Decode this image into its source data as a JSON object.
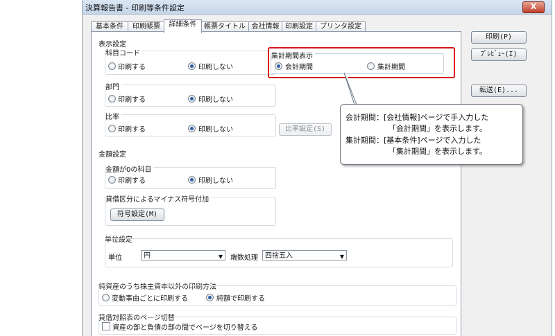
{
  "window": {
    "title": "決算報告書 - 印刷等条件設定",
    "close_label": "X"
  },
  "tabs": [
    {
      "label": "基本条件",
      "active": false
    },
    {
      "label": "印刷帳票",
      "active": false
    },
    {
      "label": "詳細条件",
      "active": true
    },
    {
      "label": "帳票タイトル",
      "active": false
    },
    {
      "label": "会社情報",
      "active": false
    },
    {
      "label": "印刷設定",
      "active": false
    },
    {
      "label": "プリンタ設定",
      "active": false
    }
  ],
  "side_buttons": {
    "print": "印刷(P)",
    "preview": "ﾌﾟﾚﾋﾞｭｰ(I)",
    "transfer": "転送(E)..."
  },
  "display_settings": {
    "title": "表示設定",
    "subject_code": {
      "label": "科目コード",
      "opt_print": "印刷する",
      "opt_noprint": "印刷しない"
    },
    "department": {
      "label": "部門",
      "opt_print": "印刷する",
      "opt_noprint": "印刷しない"
    },
    "ratio": {
      "label": "比率",
      "opt_print": "印刷する",
      "opt_noprint": "印刷しない",
      "settings_button": "比率設定(S)"
    },
    "aggregation_period": {
      "label": "集計期間表示",
      "opt_company": "会計期間",
      "opt_aggregate": "集計期間"
    }
  },
  "amount_settings": {
    "title": "金額設定",
    "zero_amount": {
      "label": "金額が0の科目",
      "opt_print": "印刷する",
      "opt_noprint": "印刷しない"
    },
    "minus_sign": {
      "label": "貸借区分によるマイナス符号付加",
      "button": "符号設定(M)"
    },
    "unit": {
      "title": "単位設定",
      "unit_label": "単位",
      "unit_value": "円",
      "rounding_label": "端数処理",
      "rounding_value": "四捨五入"
    }
  },
  "net_assets": {
    "title": "純資産のうち株主資本以外の印刷方法",
    "opt_each": "変動事由ごとに印刷する",
    "opt_total": "純額で印刷する"
  },
  "balance_page": {
    "title": "貸借対照表のページ切替",
    "checkbox_label": "資産の部と負債の部の間でページを切り替える"
  },
  "callout": {
    "line1": "会計期間：[会社情報]ページで手入力した",
    "line2": "「会計期間」を表示します。",
    "line3": "集計期間：[基本条件]ページで入力した",
    "line4": "「集計期間」を表示します。"
  },
  "colors": {
    "highlight": "#d9141b",
    "radio_selected": "#2f5fa5"
  }
}
